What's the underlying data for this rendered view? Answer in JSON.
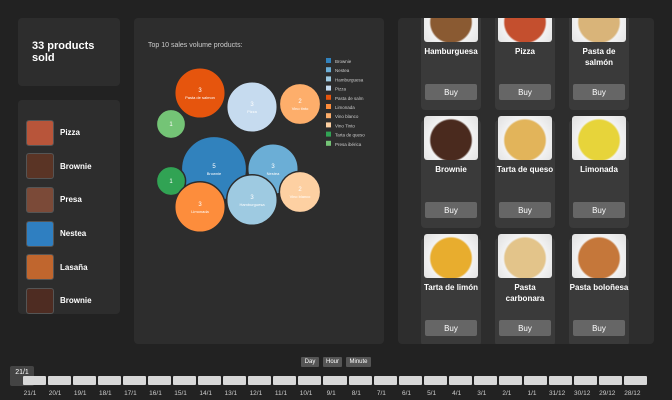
{
  "summary": {
    "count_text": "33 products sold"
  },
  "sold_list": [
    {
      "label": "Pizza",
      "icon": "pizza-icon",
      "color": "#b8553a"
    },
    {
      "label": "Brownie",
      "icon": "brownie-icon",
      "color": "#5a3425"
    },
    {
      "label": "Presa",
      "icon": "steak-icon",
      "color": "#7b4a38"
    },
    {
      "label": "Nestea",
      "icon": "drink-can-icon",
      "color": "#2f7fc1"
    },
    {
      "label": "Lasaña",
      "icon": "lasagna-icon",
      "color": "#c0662e"
    },
    {
      "label": "Brownie",
      "icon": "brownie-icon",
      "color": "#4e2c22"
    }
  ],
  "chart_data": {
    "type": "bubble",
    "title": "Top 10 sales volume products:",
    "bubbles": [
      {
        "label": "Pasta de salmon",
        "value": 3,
        "color": "#e6550d"
      },
      {
        "label": "Pizza",
        "value": 3,
        "color": "#c6dbef"
      },
      {
        "label": "Vino tinto",
        "value": 2,
        "color": "#fdae6b"
      },
      {
        "label": "Tarta de queso",
        "value": 1,
        "color": "#74c476"
      },
      {
        "label": "Brownie",
        "value": 5,
        "color": "#3182bd"
      },
      {
        "label": "Nestea",
        "value": 3,
        "color": "#6baed6"
      },
      {
        "label": "Presa ibérica",
        "value": 1,
        "color": "#31a354"
      },
      {
        "label": "Limonada",
        "value": 3,
        "color": "#fd8d3c"
      },
      {
        "label": "Hamburguesa",
        "value": 3,
        "color": "#9ecae1"
      },
      {
        "label": "Vino blanco",
        "value": 2,
        "color": "#fdd0a2"
      }
    ],
    "legend": [
      {
        "label": "Brownie",
        "color": "#3182bd"
      },
      {
        "label": "Nestea",
        "color": "#6baed6"
      },
      {
        "label": "Hamburguesa",
        "color": "#9ecae1"
      },
      {
        "label": "Pizza",
        "color": "#c6dbef"
      },
      {
        "label": "Pasta de salm",
        "color": "#e6550d"
      },
      {
        "label": "Limonada",
        "color": "#fd8d3c"
      },
      {
        "label": "Vino blanco",
        "color": "#fdae6b"
      },
      {
        "label": "Vino Tinto",
        "color": "#fdd0a2"
      },
      {
        "label": "Tarta de queso",
        "color": "#31a354"
      },
      {
        "label": "Presa ibérica",
        "color": "#74c476"
      }
    ],
    "legend_position": "right"
  },
  "products": [
    {
      "name": "Hamburguesa",
      "buy": "Buy",
      "icon": "burger-icon",
      "color": "#8a5a32"
    },
    {
      "name": "Pizza",
      "buy": "Buy",
      "icon": "pizza-icon",
      "color": "#c44f2e"
    },
    {
      "name": "Pasta de salmón",
      "buy": "Buy",
      "icon": "pasta-icon",
      "color": "#d9b479"
    },
    {
      "name": "Brownie",
      "buy": "Buy",
      "icon": "brownie-icon",
      "color": "#4a2a1e"
    },
    {
      "name": "Tarta de queso",
      "buy": "Buy",
      "icon": "cheesecake-icon",
      "color": "#e2b45a"
    },
    {
      "name": "Limonada",
      "buy": "Buy",
      "icon": "lemonade-icon",
      "color": "#e7d43a"
    },
    {
      "name": "Tarta de limón",
      "buy": "Buy",
      "icon": "lemon-tart-icon",
      "color": "#e8ad2e"
    },
    {
      "name": "Pasta carbonara",
      "buy": "Buy",
      "icon": "pasta-icon",
      "color": "#e3c48a"
    },
    {
      "name": "Pasta boloñesa",
      "buy": "Buy",
      "icon": "pasta-icon",
      "color": "#c5773a"
    }
  ],
  "timeline": {
    "granularity": [
      "Day",
      "Hour",
      "Minute"
    ],
    "current": "21/1",
    "ticks": [
      "21/1",
      "20/1",
      "19/1",
      "18/1",
      "17/1",
      "16/1",
      "15/1",
      "14/1",
      "13/1",
      "12/1",
      "11/1",
      "10/1",
      "9/1",
      "8/1",
      "7/1",
      "6/1",
      "5/1",
      "4/1",
      "3/1",
      "2/1",
      "1/1",
      "31/12",
      "30/12",
      "29/12",
      "28/12"
    ]
  }
}
